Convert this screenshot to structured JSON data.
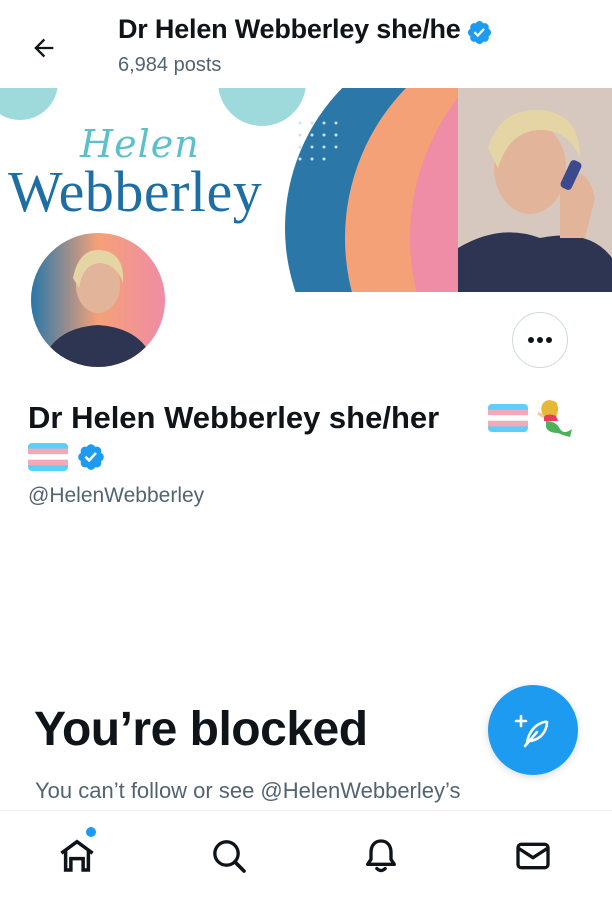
{
  "header": {
    "title": "Dr Helen Webberley she/her",
    "post_count": "6,984 posts"
  },
  "banner": {
    "script_text": "Helen",
    "serif_text": "Webberley"
  },
  "profile": {
    "display_name": "Dr Helen Webberley she/her",
    "handle": "@HelenWebberley",
    "verified": true
  },
  "blocked": {
    "title": "You’re blocked",
    "description": "You can’t follow or see @HelenWebberley’s"
  },
  "nav": {
    "items": [
      "home-icon",
      "search-icon",
      "notifications-icon",
      "messages-icon"
    ],
    "active": "home",
    "notification_dot": true
  },
  "colors": {
    "accent": "#1d9bf0",
    "text_primary": "#0f1419",
    "text_secondary": "#536471",
    "banner_teal": "#5bc0c9",
    "banner_blue": "#2a77a8",
    "banner_orange": "#f5a177",
    "banner_pink": "#ef8ca6"
  }
}
